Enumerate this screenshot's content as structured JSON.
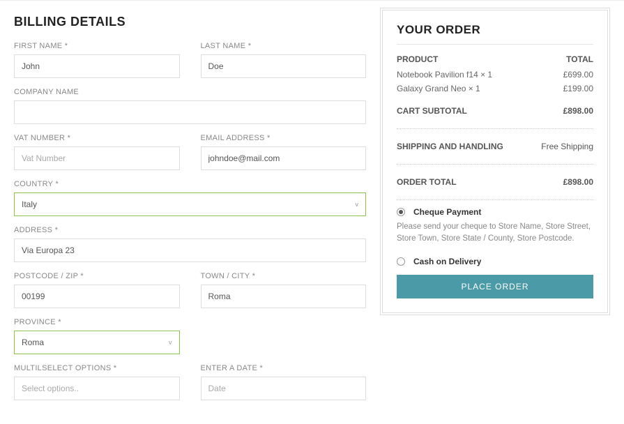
{
  "billing": {
    "title": "BILLING DETAILS",
    "first_name": {
      "label": "FIRST NAME *",
      "value": "John"
    },
    "last_name": {
      "label": "LAST NAME *",
      "value": "Doe"
    },
    "company": {
      "label": "COMPANY NAME",
      "value": ""
    },
    "vat": {
      "label": "VAT NUMBER *",
      "placeholder": "Vat Number",
      "value": ""
    },
    "email": {
      "label": "EMAIL ADDRESS *",
      "value": "johndoe@mail.com"
    },
    "country": {
      "label": "COUNTRY *",
      "value": "Italy"
    },
    "address": {
      "label": "ADDRESS *",
      "value": "Via Europa 23"
    },
    "postcode": {
      "label": "POSTCODE / ZIP *",
      "value": "00199"
    },
    "town": {
      "label": "TOWN / CITY *",
      "value": "Roma"
    },
    "province": {
      "label": "PROVINCE *",
      "value": "Roma"
    },
    "multiselect": {
      "label": "MULTILSELECT OPTIONS *",
      "placeholder": "Select options.."
    },
    "date": {
      "label": "ENTER A DATE *",
      "placeholder": "Date"
    }
  },
  "order": {
    "title": "YOUR ORDER",
    "header_product": "PRODUCT",
    "header_total": "TOTAL",
    "items": [
      {
        "name": "Notebook Pavilion f14 × 1",
        "price": "£699.00"
      },
      {
        "name": "Galaxy Grand Neo × 1",
        "price": "£199.00"
      }
    ],
    "subtotal_label": "CART SUBTOTAL",
    "subtotal_value": "£898.00",
    "shipping_label": "SHIPPING AND HANDLING",
    "shipping_value": "Free Shipping",
    "total_label": "ORDER TOTAL",
    "total_value": "£898.00",
    "payment": {
      "cheque_label": "Cheque Payment",
      "cheque_desc": "Please send your cheque to Store Name, Store Street, Store Town, Store State / County, Store Postcode.",
      "cod_label": "Cash on Delivery"
    },
    "place_button": "PLACE ORDER"
  }
}
